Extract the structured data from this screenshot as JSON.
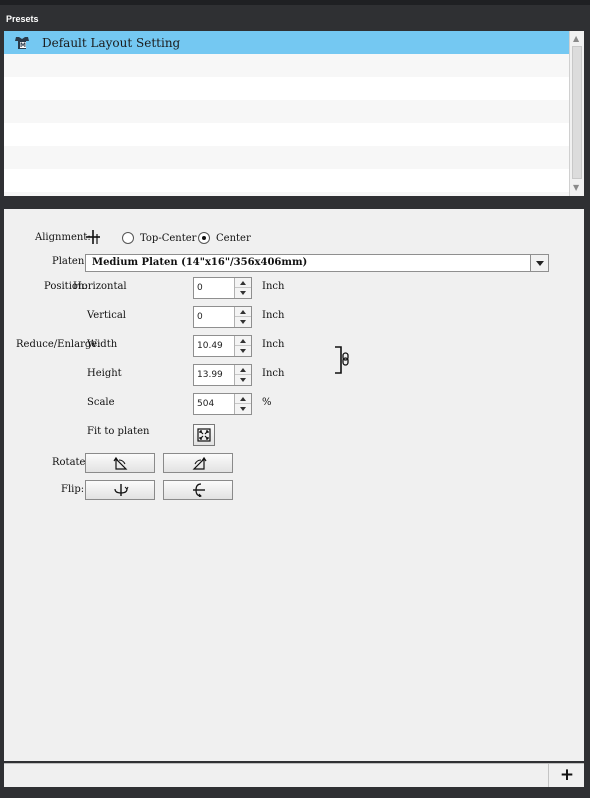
{
  "presets": {
    "title": "Presets",
    "items": [
      {
        "label": "Default Layout Setting",
        "selected": true
      }
    ]
  },
  "layout": {
    "alignment": {
      "label": "Alignment:",
      "options": [
        "Top-Center",
        "Center"
      ],
      "selected": "Center"
    },
    "platen": {
      "label": "Platen:",
      "value": "Medium Platen (14\"x16\"/356x406mm)"
    },
    "position": {
      "label": "Position:",
      "horizontal_label": "Horizontal",
      "horizontal_value": "0",
      "vertical_label": "Vertical",
      "vertical_value": "0",
      "unit": "Inch"
    },
    "size": {
      "label": "Reduce/Enlarge:",
      "width_label": "Width",
      "width_value": "10.49",
      "height_label": "Height",
      "height_value": "13.99",
      "unit": "Inch",
      "scale_label": "Scale",
      "scale_value": "504",
      "scale_unit": "%"
    },
    "fit": {
      "label": "Fit to platen"
    },
    "rotate": {
      "label": "Rotate:"
    },
    "flip": {
      "label": "Flip:"
    }
  },
  "footer": {
    "add_label": "+"
  },
  "colors": {
    "selection": "#74c8f2",
    "chrome": "#2f3033",
    "panel": "#f0f0f0"
  }
}
